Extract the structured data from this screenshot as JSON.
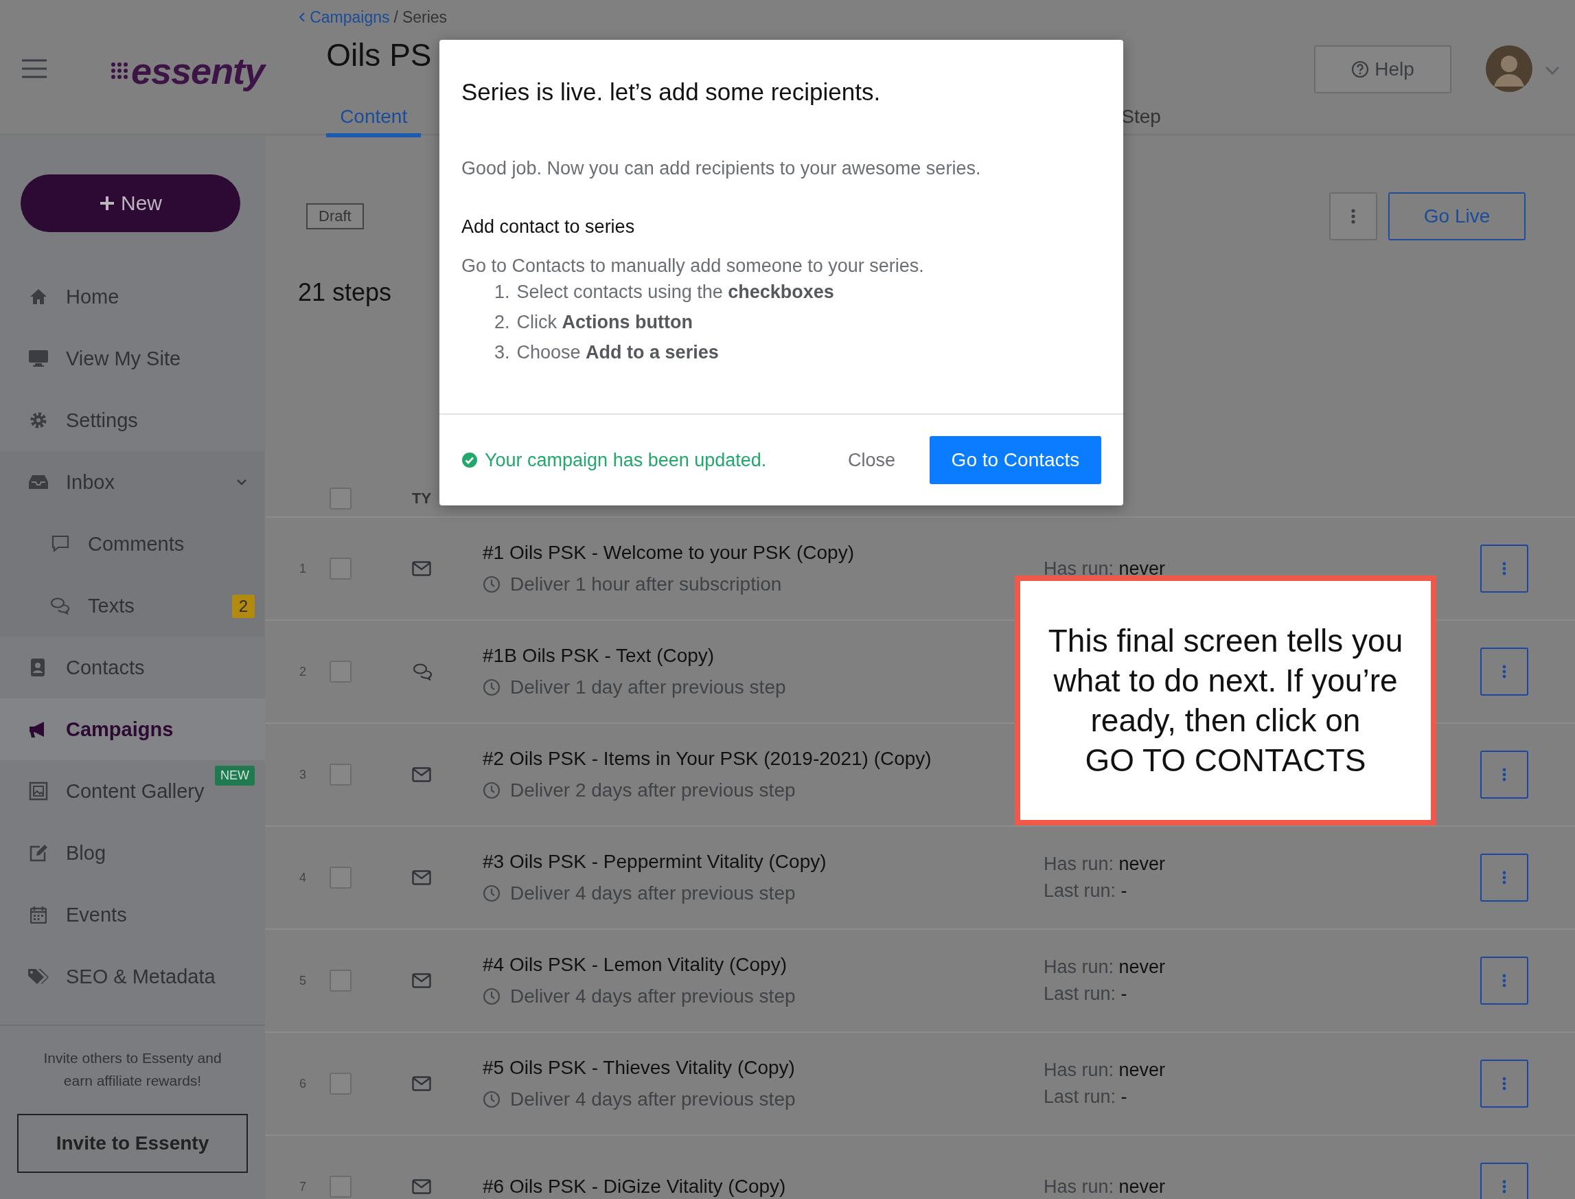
{
  "header": {
    "breadcrumb": {
      "link": "Campaigns",
      "separator": "/",
      "current": "Series"
    },
    "brand": "essenty",
    "title": "Oils PS",
    "help_button": "Help"
  },
  "tabs": [
    {
      "label": "Content",
      "selected": true
    },
    {
      "label": "Step",
      "selected": false
    }
  ],
  "sidebar": {
    "new_button": "New",
    "items": [
      {
        "label": "Home",
        "selected": false
      },
      {
        "label": "View My Site",
        "selected": false
      },
      {
        "label": "Settings",
        "selected": false
      },
      {
        "label": "Inbox",
        "selected": false,
        "expanded": true,
        "children": [
          {
            "label": "Comments",
            "selected": false
          },
          {
            "label": "Texts",
            "selected": false,
            "badge": {
              "text": "2",
              "kind": "count"
            }
          }
        ]
      },
      {
        "label": "Contacts",
        "selected": false
      },
      {
        "label": "Campaigns",
        "selected": true
      },
      {
        "label": "Content Gallery",
        "selected": false,
        "badge": {
          "text": "NEW",
          "kind": "new"
        }
      },
      {
        "label": "Blog",
        "selected": false
      },
      {
        "label": "Events",
        "selected": false
      },
      {
        "label": "SEO & Metadata",
        "selected": false
      }
    ],
    "invite_text": "Invite others to Essenty and earn affiliate rewards!",
    "invite_button": "Invite to Essenty"
  },
  "status_badge": "Draft",
  "go_live_button": "Go Live",
  "steps_count": "21 steps",
  "table": {
    "header_checked": false,
    "columns": [
      "TY"
    ],
    "rows": [
      {
        "number": "1",
        "checked": false,
        "kind": "email",
        "title": "#1 Oils PSK - Welcome to your PSK (Copy)",
        "schedule": "Deliver 1 hour after subscription",
        "status_lines": [
          "Has run: **never**"
        ]
      },
      {
        "number": "2",
        "checked": false,
        "kind": "text",
        "title": "#1B Oils PSK - Text (Copy)",
        "schedule": "Deliver 1 day after previous step"
      },
      {
        "number": "3",
        "checked": false,
        "kind": "email",
        "title": "#2 Oils PSK - Items in Your PSK (2019-2021) (Copy)",
        "schedule": "Deliver 2 days after previous step"
      },
      {
        "number": "4",
        "checked": false,
        "kind": "email",
        "title": "#3 Oils PSK - Peppermint Vitality (Copy)",
        "schedule": "Deliver 4 days after previous step",
        "status_lines": [
          "Has run: **never**",
          "Last run: **-**"
        ]
      },
      {
        "number": "5",
        "checked": false,
        "kind": "email",
        "title": "#4 Oils PSK - Lemon Vitality (Copy)",
        "schedule": "Deliver 4 days after previous step",
        "status_lines": [
          "Has run: **never**",
          "Last run: **-**"
        ]
      },
      {
        "number": "6",
        "checked": false,
        "kind": "email",
        "title": "#5 Oils PSK - Thieves Vitality (Copy)",
        "schedule": "Deliver 4 days after previous step",
        "status_lines": [
          "Has run: **never**",
          "Last run: **-**"
        ]
      },
      {
        "number": "7",
        "checked": false,
        "kind": "email",
        "title": "#6 Oils PSK - DiGize Vitality (Copy)",
        "status_lines": [
          "Has run: **never**"
        ]
      }
    ]
  },
  "modal": {
    "title": "Series is live. let’s add some recipients.",
    "intro": "Good job. Now you can add recipients to your awesome series.",
    "section_heading": "Add contact to series",
    "section_text": "Go to Contacts to manually add someone to your series.",
    "steps": [
      {
        "number": "1.",
        "text": "Select contacts using the **checkboxes**"
      },
      {
        "number": "2.",
        "text": "Click **Actions button**"
      },
      {
        "number": "3.",
        "text": "Choose **Add to a series**"
      }
    ],
    "status": "Your campaign has been updated.",
    "close_button": "Close",
    "primary_button": "Go to Contacts"
  },
  "callout": {
    "text": "This final screen tells you what to do next. If you’re ready, then click on\nGO TO CONTACTS"
  }
}
